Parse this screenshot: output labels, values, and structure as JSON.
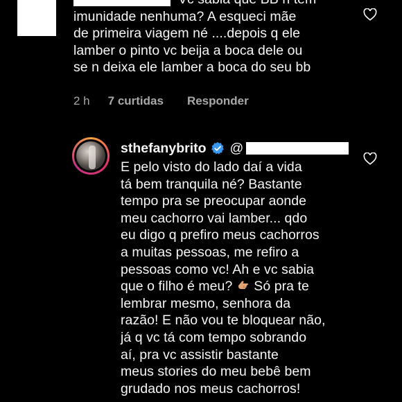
{
  "comments": [
    {
      "text_line1_suffix": "Vc sabia que BB n tem",
      "text_rest": "imunidade nenhuma? A esqueci mãe\nde primeira viagem né ....depois q ele\nlamber o pinto vc beija a boca dele ou\nse n deixa ele lamber a boca do seu bb",
      "time": "2 h",
      "likes": "7 curtidas",
      "reply": "Responder"
    },
    {
      "username": "sthefanybrito",
      "mention_prefix": "@",
      "text_before_emoji": "E pelo visto do lado daí a vida\ntá bem tranquila né? Bastante\ntempo pra se preocupar aonde\nmeu cachorro vai lamber... qdo\neu digo q prefiro meus cachorros\na muitas pessoas, me refiro a\npessoas como vc! Ah e vc sabia\nque o filho é meu? ",
      "text_after_emoji": " Só pra te\nlembrar mesmo, senhora da\nrazão! E não vou te bloquear não,\njá q vc tá com tempo sobrando\naí, pra vc assistir bastante\nmeus stories do meu bebê bem\ngrudado nos meus cachorros!"
    }
  ],
  "colors": {
    "background": "#000000",
    "text": "#f5f5f5",
    "meta": "#a8a8a8",
    "verified": "#3897f0"
  },
  "icons": {
    "like": "heart-outline-icon",
    "verified": "verified-badge-icon",
    "emoji": "pointing-hand-emoji"
  }
}
